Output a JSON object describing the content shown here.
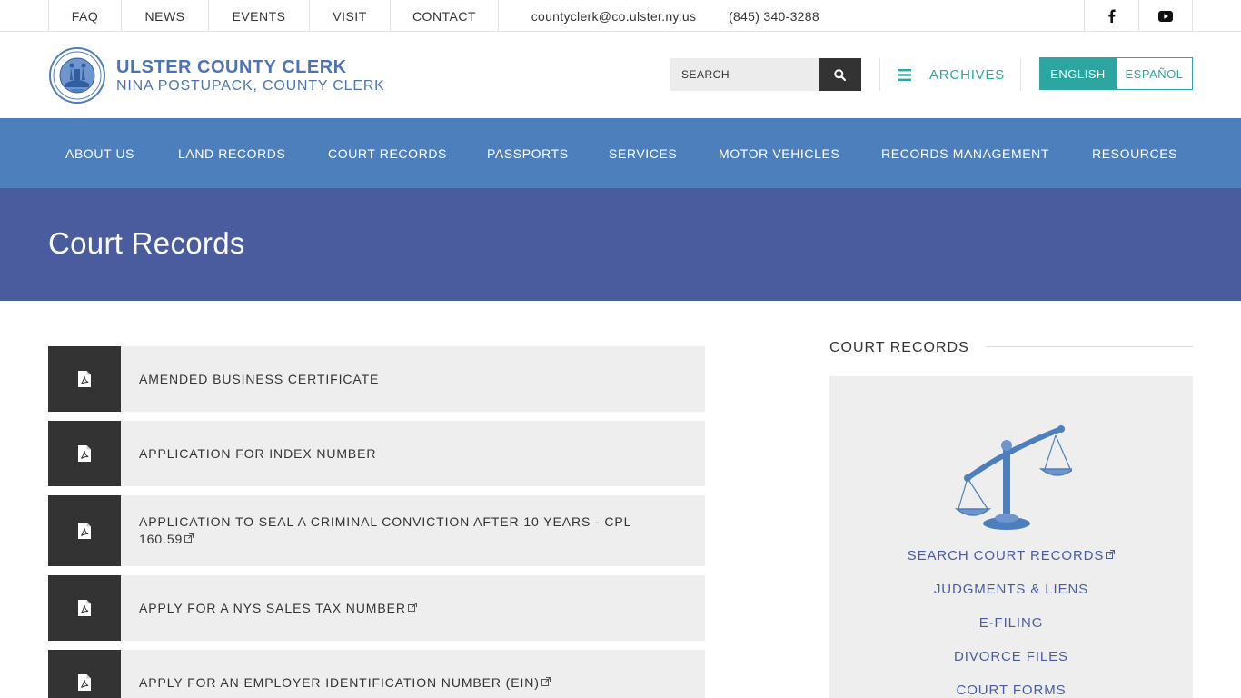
{
  "topbar": {
    "links": [
      "FAQ",
      "NEWS",
      "EVENTS",
      "VISIT",
      "CONTACT"
    ],
    "email": "countyclerk@co.ulster.ny.us",
    "phone": "(845) 340-3288",
    "social": [
      "facebook-icon",
      "youtube-icon"
    ]
  },
  "header": {
    "title": "ULSTER COUNTY CLERK",
    "subtitle": "NINA POSTUPACK, COUNTY CLERK",
    "search_placeholder": "SEARCH",
    "archives_label": "ARCHIVES",
    "lang_english": "ENGLISH",
    "lang_spanish": "ESPAÑOL"
  },
  "nav": [
    "ABOUT US",
    "LAND RECORDS",
    "COURT RECORDS",
    "PASSPORTS",
    "SERVICES",
    "MOTOR VEHICLES",
    "RECORDS MANAGEMENT",
    "RESOURCES"
  ],
  "banner": {
    "title": "Court Records"
  },
  "documents": [
    {
      "label": "AMENDED BUSINESS CERTIFICATE",
      "external": false
    },
    {
      "label": "APPLICATION FOR INDEX NUMBER",
      "external": false
    },
    {
      "label": "APPLICATION TO SEAL A CRIMINAL CONVICTION AFTER 10 YEARS - CPL 160.59",
      "external": true
    },
    {
      "label": "APPLY FOR A NYS SALES TAX NUMBER",
      "external": true
    },
    {
      "label": "APPLY FOR AN EMPLOYER IDENTIFICATION NUMBER (EIN)",
      "external": true
    }
  ],
  "sidebar": {
    "title": "COURT RECORDS",
    "links": [
      {
        "label": "SEARCH COURT RECORDS",
        "external": true
      },
      {
        "label": "JUDGMENTS & LIENS",
        "external": false
      },
      {
        "label": "E-FILING",
        "external": false
      },
      {
        "label": "DIVORCE FILES",
        "external": false
      },
      {
        "label": "COURT FORMS",
        "external": false
      }
    ]
  },
  "colors": {
    "brand_blue": "#4e73b3",
    "nav_blue": "#4e7fbd",
    "banner_indigo": "#4b5c9e",
    "teal": "#2ba6a0",
    "dark": "#333333"
  }
}
